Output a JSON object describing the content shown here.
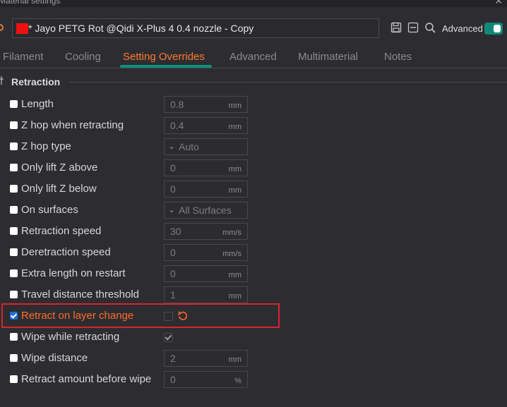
{
  "window": {
    "title": "Material settings"
  },
  "preset": {
    "name": "* Jayo PETG Rot @Qidi X-Plus 4 0.4 nozzle - Copy",
    "swatch_color": "#ee1111"
  },
  "toolbar": {
    "advanced_label": "Advanced",
    "advanced_on": true
  },
  "tabs": [
    {
      "label": "Filament",
      "active": false
    },
    {
      "label": "Cooling",
      "active": false
    },
    {
      "label": "Setting Overrides",
      "active": true
    },
    {
      "label": "Advanced",
      "active": false
    },
    {
      "label": "Multimaterial",
      "active": false
    },
    {
      "label": "Notes",
      "active": false
    }
  ],
  "section": {
    "title": "Retraction"
  },
  "rows": [
    {
      "label": "Length",
      "value": "0.8",
      "unit": "mm",
      "checked": false
    },
    {
      "label": "Z hop when retracting",
      "value": "0.4",
      "unit": "mm",
      "checked": false
    },
    {
      "label": "Z hop type",
      "value": "Auto",
      "checked": false
    },
    {
      "label": "Only lift Z above",
      "value": "0",
      "unit": "mm",
      "checked": false
    },
    {
      "label": "Only lift Z below",
      "value": "0",
      "unit": "mm",
      "checked": false
    },
    {
      "label": "On surfaces",
      "value": "All Surfaces",
      "checked": false
    },
    {
      "label": "Retraction speed",
      "value": "30",
      "unit": "mm/s",
      "checked": false
    },
    {
      "label": "Deretraction speed",
      "value": "0",
      "unit": "mm/s",
      "checked": false
    },
    {
      "label": "Extra length on restart",
      "value": "0",
      "unit": "mm",
      "checked": false
    },
    {
      "label": "Travel distance threshold",
      "value": "1",
      "unit": "mm",
      "checked": false
    },
    {
      "label": "Retract on layer change",
      "checked": true,
      "value_checked": false
    },
    {
      "label": "Wipe while retracting",
      "checked": false,
      "value_checked": true
    },
    {
      "label": "Wipe distance",
      "value": "2",
      "unit": "mm",
      "checked": false
    },
    {
      "label": "Retract amount before wipe",
      "value": "0",
      "unit": "%",
      "checked": false
    }
  ],
  "colors": {
    "accent": "#ff7a2f",
    "tab_indicator": "#0e8f7b",
    "toggle": "#0f8a77",
    "highlight": "#d9232f"
  }
}
